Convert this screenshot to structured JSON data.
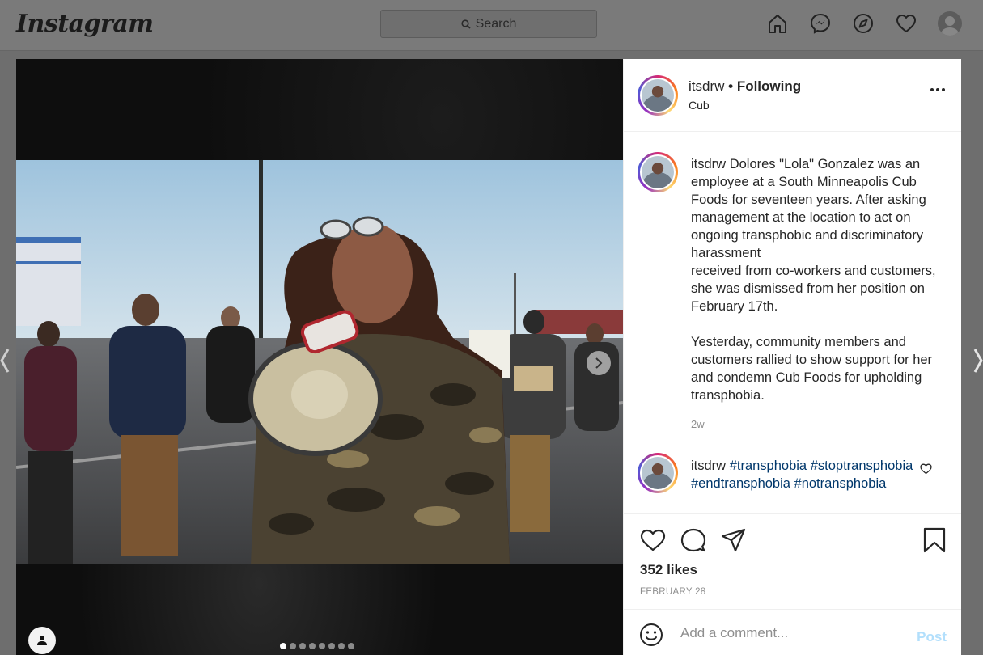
{
  "nav": {
    "logo": "Instagram",
    "search_placeholder": "Search",
    "icons": [
      "home-icon",
      "messenger-icon",
      "explore-icon",
      "activity-heart-icon",
      "profile-avatar"
    ]
  },
  "post": {
    "username": "itsdrw",
    "follow_status": "• Following",
    "location": "Cub",
    "caption_user": "itsdrw",
    "caption_text": "Dolores \"Lola\" Gonzalez was an employee at a South Minneapolis Cub Foods for seventeen years. After asking management at the location to act on ongoing transphobic and discriminatory harassment\nreceived from co-workers and customers, she was dismissed from her position on February 17th.\n\nYesterday, community members and customers rallied to show support for her and condemn Cub Foods for upholding transphobia.",
    "caption_age": "2w",
    "comment2": {
      "user": "itsdrw",
      "tags": [
        "#transphobia",
        "#stoptransphobia",
        "#endtransphobia",
        "#notransphobia"
      ]
    },
    "likes": "352 likes",
    "date": "FEBRUARY 28",
    "add_comment_placeholder": "Add a comment...",
    "post_button": "Post",
    "carousel": {
      "total": 8,
      "current": 1
    }
  },
  "colors": {
    "link": "#00376b",
    "post_button": "#b2dffc",
    "secondary_text": "#8e8e8e"
  }
}
